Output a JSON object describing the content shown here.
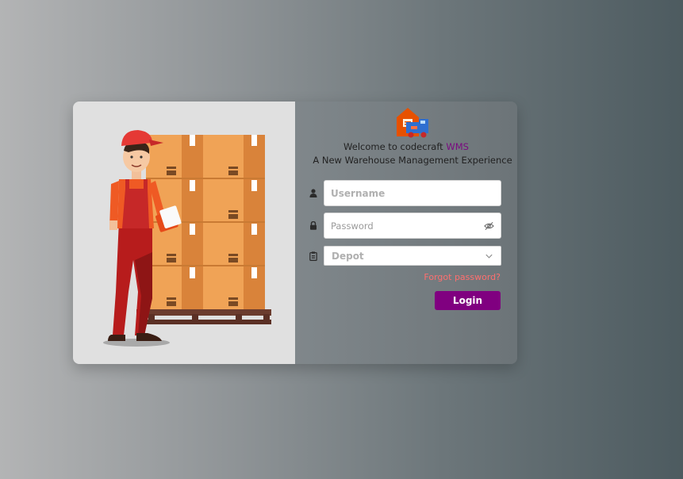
{
  "brand": {
    "welcome_prefix": "Welcome to codecraft",
    "welcome_brand": "WMS",
    "subtitle": "A New Warehouse Management Experience"
  },
  "form": {
    "username_placeholder": "Username",
    "password_placeholder": "Password",
    "depot_placeholder": "Depot",
    "forgot_label": "Forgot password?",
    "login_label": "Login"
  },
  "icons": {
    "username": "user-icon",
    "password": "lock-icon",
    "depot": "clipboard-icon",
    "password_toggle": "eye-slash-icon",
    "depot_dropdown": "chevron-down-icon",
    "logo": "warehouse-truck-icon"
  },
  "colors": {
    "brand_purple": "#800080",
    "forgot_link": "#ff6f6f",
    "left_panel": "#e0e0e0"
  }
}
